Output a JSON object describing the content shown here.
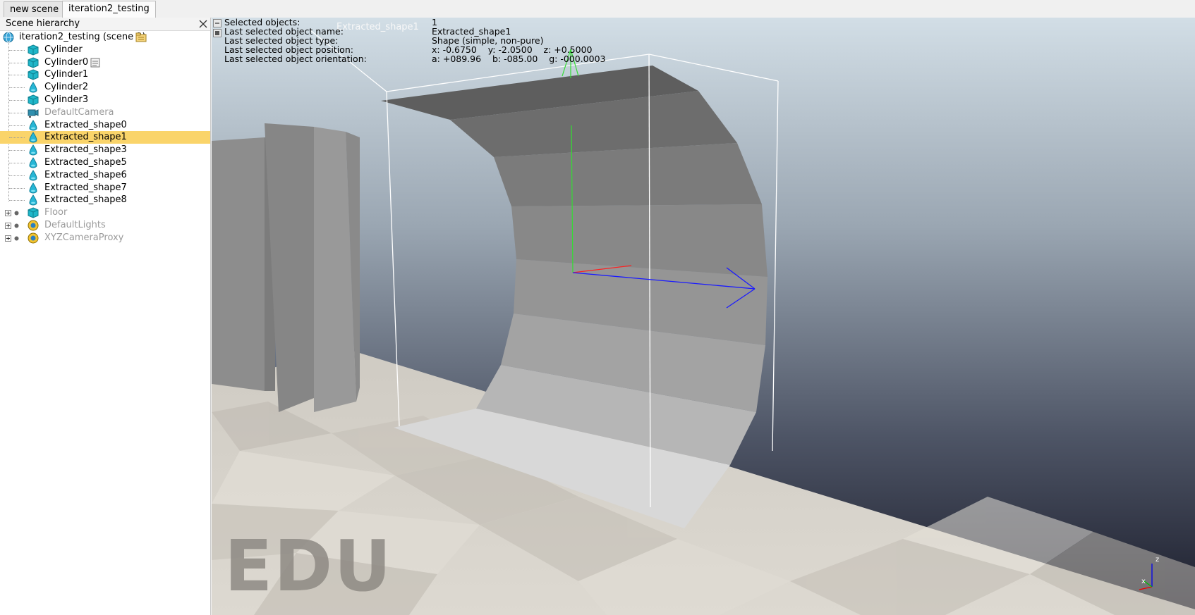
{
  "tabs": [
    {
      "label": "new scene",
      "active": false
    },
    {
      "label": "iteration2_testing",
      "active": true
    }
  ],
  "panel": {
    "title": "Scene hierarchy",
    "root": {
      "label": "iteration2_testing (scene 2)",
      "icon": "globe-icon"
    },
    "items": [
      {
        "label": "Cylinder",
        "icon": "cube-icon",
        "state": "normal"
      },
      {
        "label": "Cylinder0",
        "icon": "cube-icon",
        "state": "normal",
        "extra_icon": "script-icon"
      },
      {
        "label": "Cylinder1",
        "icon": "cube-icon",
        "state": "normal"
      },
      {
        "label": "Cylinder2",
        "icon": "shape-icon",
        "state": "normal"
      },
      {
        "label": "Cylinder3",
        "icon": "cube-icon",
        "state": "normal"
      },
      {
        "label": "DefaultCamera",
        "icon": "camera-icon",
        "state": "dim"
      },
      {
        "label": "Extracted_shape0",
        "icon": "shape-icon",
        "state": "normal"
      },
      {
        "label": "Extracted_shape1",
        "icon": "shape-icon",
        "state": "selected"
      },
      {
        "label": "Extracted_shape3",
        "icon": "shape-icon",
        "state": "normal"
      },
      {
        "label": "Extracted_shape5",
        "icon": "shape-icon",
        "state": "normal"
      },
      {
        "label": "Extracted_shape6",
        "icon": "shape-icon",
        "state": "normal"
      },
      {
        "label": "Extracted_shape7",
        "icon": "shape-icon",
        "state": "normal"
      },
      {
        "label": "Extracted_shape8",
        "icon": "shape-icon",
        "state": "normal"
      },
      {
        "label": "Floor",
        "icon": "cube-icon",
        "state": "dim",
        "expandable": true
      },
      {
        "label": "DefaultLights",
        "icon": "model-icon",
        "state": "dim",
        "expandable": true
      },
      {
        "label": "XYZCameraProxy",
        "icon": "model-icon",
        "state": "dim",
        "expandable": true
      }
    ]
  },
  "info": {
    "labels": [
      "Selected objects:",
      "Last selected object name:",
      "Last selected object type:",
      "Last selected object position:",
      "Last selected object orientation:"
    ],
    "values": [
      "1",
      "Extracted_shape1",
      "Shape (simple, non-pure)",
      "x: -0.6750    y: -2.0500    z: +0.5000",
      "a: +089.96    b: -085.00    g: -000.0003"
    ]
  },
  "viewport": {
    "object_label": "Extracted_shape1",
    "watermark": "EDU",
    "axes_labels": {
      "x": "x",
      "z": "z"
    }
  },
  "colors": {
    "selection": "#fad46a",
    "sky_top": "#d0dde6",
    "sky_bottom": "#1b1e2c",
    "shape_top": "#5f5f5f",
    "shape_bottom": "#dadada",
    "axis_x": "#ff0000",
    "axis_y": "#00c000",
    "axis_z": "#0000ff"
  }
}
